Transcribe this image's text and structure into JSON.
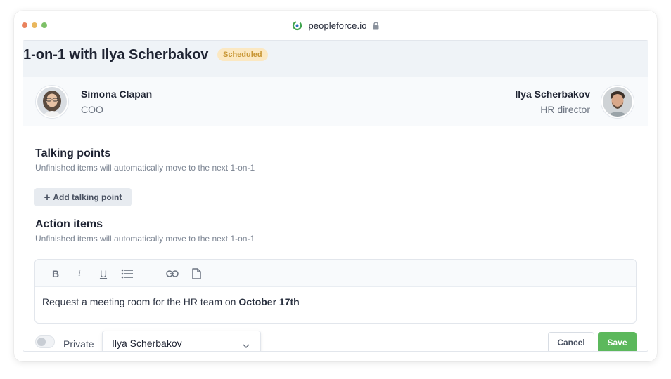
{
  "browser": {
    "url": "peopleforce.io"
  },
  "meeting": {
    "title": "1-on-1 with Ilya Scherbakov",
    "status": "Scheduled"
  },
  "participants": {
    "left": {
      "name": "Simona Clapan",
      "role": "COO"
    },
    "right": {
      "name": "Ilya Scherbakov",
      "role": "HR director"
    }
  },
  "talking_points": {
    "title": "Talking points",
    "subtitle": "Unfinished items will automatically move to the next 1-on-1",
    "add_label": "Add talking point"
  },
  "action_items": {
    "title": "Action items",
    "subtitle": "Unfinished items will automatically move to the next 1-on-1"
  },
  "editor": {
    "toolbar": {
      "bold": "B",
      "italic": "i",
      "underline": "U",
      "icons": [
        "bullet-list-icon",
        "link-icon",
        "file-icon"
      ]
    },
    "content_text": "Request a meeting room for the HR team on ",
    "content_bold": "October 17th"
  },
  "footer": {
    "private_label": "Private",
    "private_enabled": false,
    "assignee": "Ilya Scherbakov",
    "cancel_label": "Cancel",
    "save_label": "Save"
  },
  "colors": {
    "accent_green": "#5cb85c",
    "badge_bg": "#fbe8c2",
    "badge_text": "#c79533"
  }
}
